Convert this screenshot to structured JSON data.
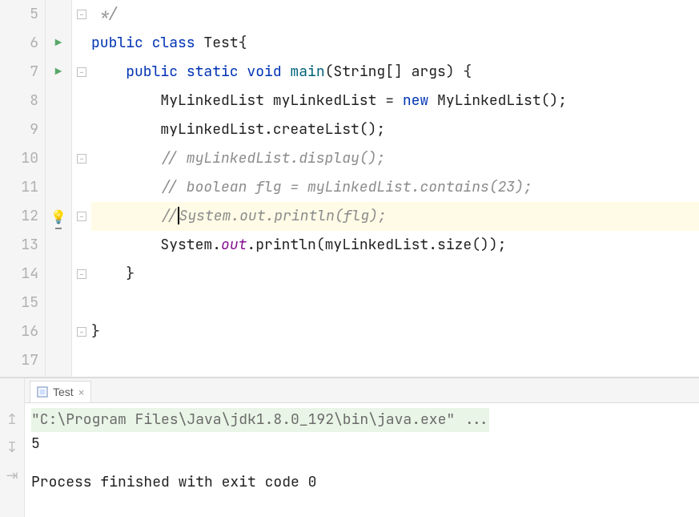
{
  "gutter": {
    "lines": [
      "5",
      "6",
      "7",
      "8",
      "9",
      "10",
      "11",
      "12",
      "13",
      "14",
      "15",
      "16",
      "17"
    ]
  },
  "iconCol": {
    "run6": "▶",
    "run7": "▶",
    "bulb12": "💡"
  },
  "foldCol": {
    "l5": "⌃",
    "l6": "",
    "l7": "⊟",
    "l8": "",
    "l9": "",
    "l10": "⊟",
    "l11": "",
    "l12": "⌃",
    "l13": "",
    "l14": "⌃",
    "l15": "",
    "l16": "⌃",
    "l17": ""
  },
  "code": {
    "line5_comment": " */",
    "line6": {
      "kw1": "public ",
      "kw2": "class ",
      "name": "Test{"
    },
    "line7": {
      "pad": "    ",
      "kw1": "public ",
      "kw2": "static ",
      "kw3": "void ",
      "method": "main",
      "rest": "(String[] args) {"
    },
    "line8": {
      "pad": "        ",
      "a": "MyLinkedList myLinkedList = ",
      "kw": "new ",
      "b": "MyLinkedList();"
    },
    "line9": "        myLinkedList.createList();",
    "line10_comment": "        // myLinkedList.display();",
    "line11_comment": "        // boolean flg = myLinkedList.contains(23);",
    "line12": {
      "pad": "        ",
      "a": "//",
      "b": "System.out.println(flg);"
    },
    "line13": {
      "pad": "        ",
      "a": "System.",
      "field": "out",
      "b": ".println(myLinkedList.size());"
    },
    "line14": "    }",
    "line15": "",
    "line16": "}",
    "line17": ""
  },
  "run": {
    "tabName": "Test",
    "tabClose": "×",
    "cmdLine": "\"C:\\Program Files\\Java\\jdk1.8.0_192\\bin\\java.exe\" ...",
    "output1": "5",
    "exitLine": "Process finished with exit code 0"
  },
  "sideIcons": {
    "up": "↥",
    "down": "↧",
    "wrap": "⇥"
  }
}
